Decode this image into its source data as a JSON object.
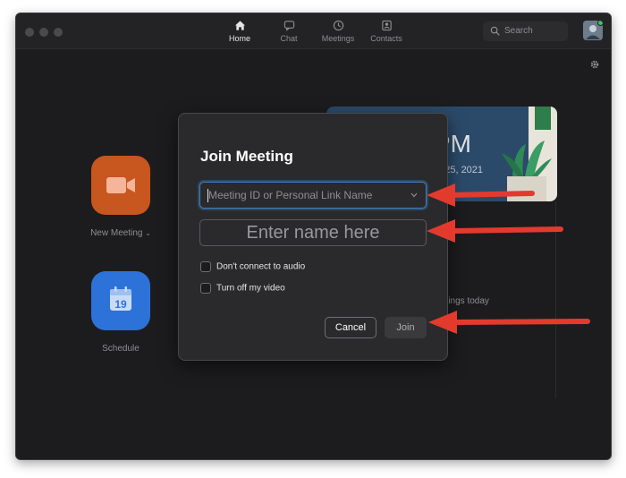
{
  "nav": {
    "tabs": [
      {
        "label": "Home",
        "icon": "home-icon",
        "active": true
      },
      {
        "label": "Chat",
        "icon": "chat-icon",
        "active": false
      },
      {
        "label": "Meetings",
        "icon": "clock-icon",
        "active": false
      },
      {
        "label": "Contacts",
        "icon": "contacts-icon",
        "active": false
      }
    ],
    "search_placeholder": "Search"
  },
  "home": {
    "new_meeting_label": "New Meeting",
    "schedule_label": "Schedule",
    "calendar_day": "19",
    "card_time": "PM",
    "card_date": "ry 25, 2021",
    "no_meetings_text": "etings today"
  },
  "dialog": {
    "title": "Join Meeting",
    "meeting_id_placeholder": "Meeting ID or Personal Link Name",
    "name_placeholder": "Enter name here",
    "option_audio": "Don't connect to audio",
    "option_video": "Turn off my video",
    "cancel_label": "Cancel",
    "join_label": "Join"
  },
  "colors": {
    "window_bg": "#1c1c1e",
    "dialog_bg": "#2a2a2c",
    "focus_blue": "#3b82c4",
    "new_meeting_orange": "#c7561f",
    "schedule_blue": "#2d72d9",
    "annotation_red": "#e23b2e"
  }
}
